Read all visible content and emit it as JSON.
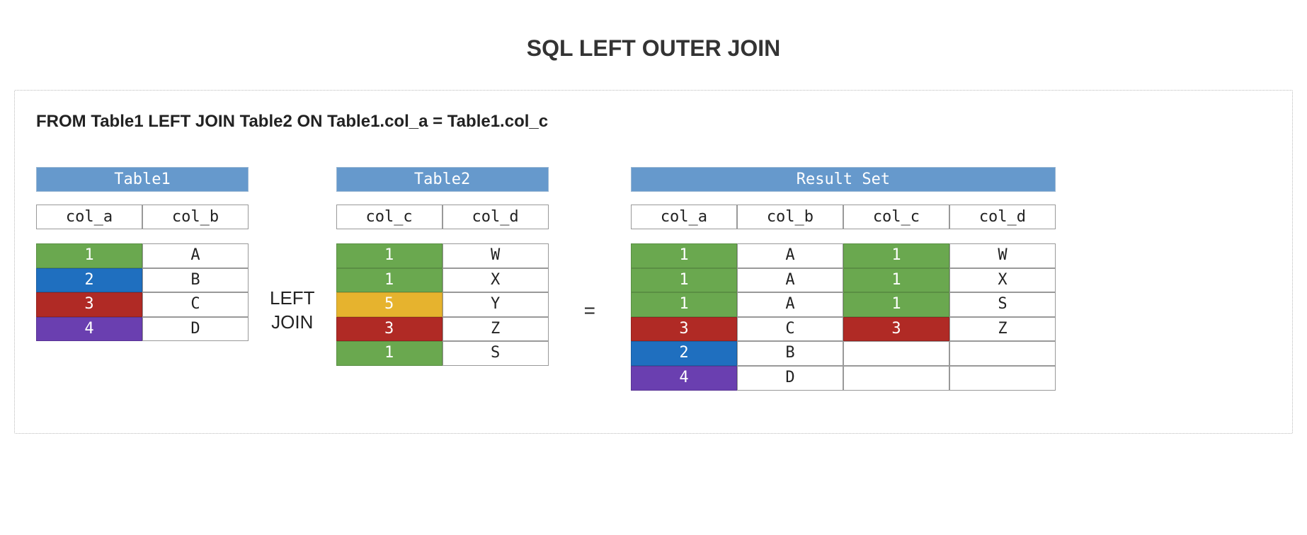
{
  "title": "SQL LEFT OUTER JOIN",
  "sql_clause": "FROM Table1 LEFT JOIN Table2 ON Table1.col_a = Table1.col_c",
  "operator_left_join": "LEFT\nJOIN",
  "operator_equals": "=",
  "colors": {
    "green": "#6aa84f",
    "blue": "#1f6fbf",
    "red": "#b02a25",
    "purple": "#6a3fb0",
    "yellow": "#e6b32e",
    "header": "#6699cc"
  },
  "table1": {
    "title": "Table1",
    "columns": [
      "col_a",
      "col_b"
    ],
    "rows": [
      {
        "col_a": "1",
        "col_a_color": "green",
        "col_b": "A"
      },
      {
        "col_a": "2",
        "col_a_color": "blue",
        "col_b": "B"
      },
      {
        "col_a": "3",
        "col_a_color": "red",
        "col_b": "C"
      },
      {
        "col_a": "4",
        "col_a_color": "purple",
        "col_b": "D"
      }
    ]
  },
  "table2": {
    "title": "Table2",
    "columns": [
      "col_c",
      "col_d"
    ],
    "rows": [
      {
        "col_c": "1",
        "col_c_color": "green",
        "col_d": "W"
      },
      {
        "col_c": "1",
        "col_c_color": "green",
        "col_d": "X"
      },
      {
        "col_c": "5",
        "col_c_color": "yellow",
        "col_d": "Y"
      },
      {
        "col_c": "3",
        "col_c_color": "red",
        "col_d": "Z"
      },
      {
        "col_c": "1",
        "col_c_color": "green",
        "col_d": "S"
      }
    ]
  },
  "result": {
    "title": "Result Set",
    "columns": [
      "col_a",
      "col_b",
      "col_c",
      "col_d"
    ],
    "rows": [
      {
        "col_a": "1",
        "col_a_color": "green",
        "col_b": "A",
        "col_c": "1",
        "col_c_color": "green",
        "col_d": "W"
      },
      {
        "col_a": "1",
        "col_a_color": "green",
        "col_b": "A",
        "col_c": "1",
        "col_c_color": "green",
        "col_d": "X"
      },
      {
        "col_a": "1",
        "col_a_color": "green",
        "col_b": "A",
        "col_c": "1",
        "col_c_color": "green",
        "col_d": "S"
      },
      {
        "col_a": "3",
        "col_a_color": "red",
        "col_b": "C",
        "col_c": "3",
        "col_c_color": "red",
        "col_d": "Z"
      },
      {
        "col_a": "2",
        "col_a_color": "blue",
        "col_b": "B",
        "col_c": "",
        "col_c_color": "",
        "col_d": ""
      },
      {
        "col_a": "4",
        "col_a_color": "purple",
        "col_b": "D",
        "col_c": "",
        "col_c_color": "",
        "col_d": ""
      }
    ]
  }
}
